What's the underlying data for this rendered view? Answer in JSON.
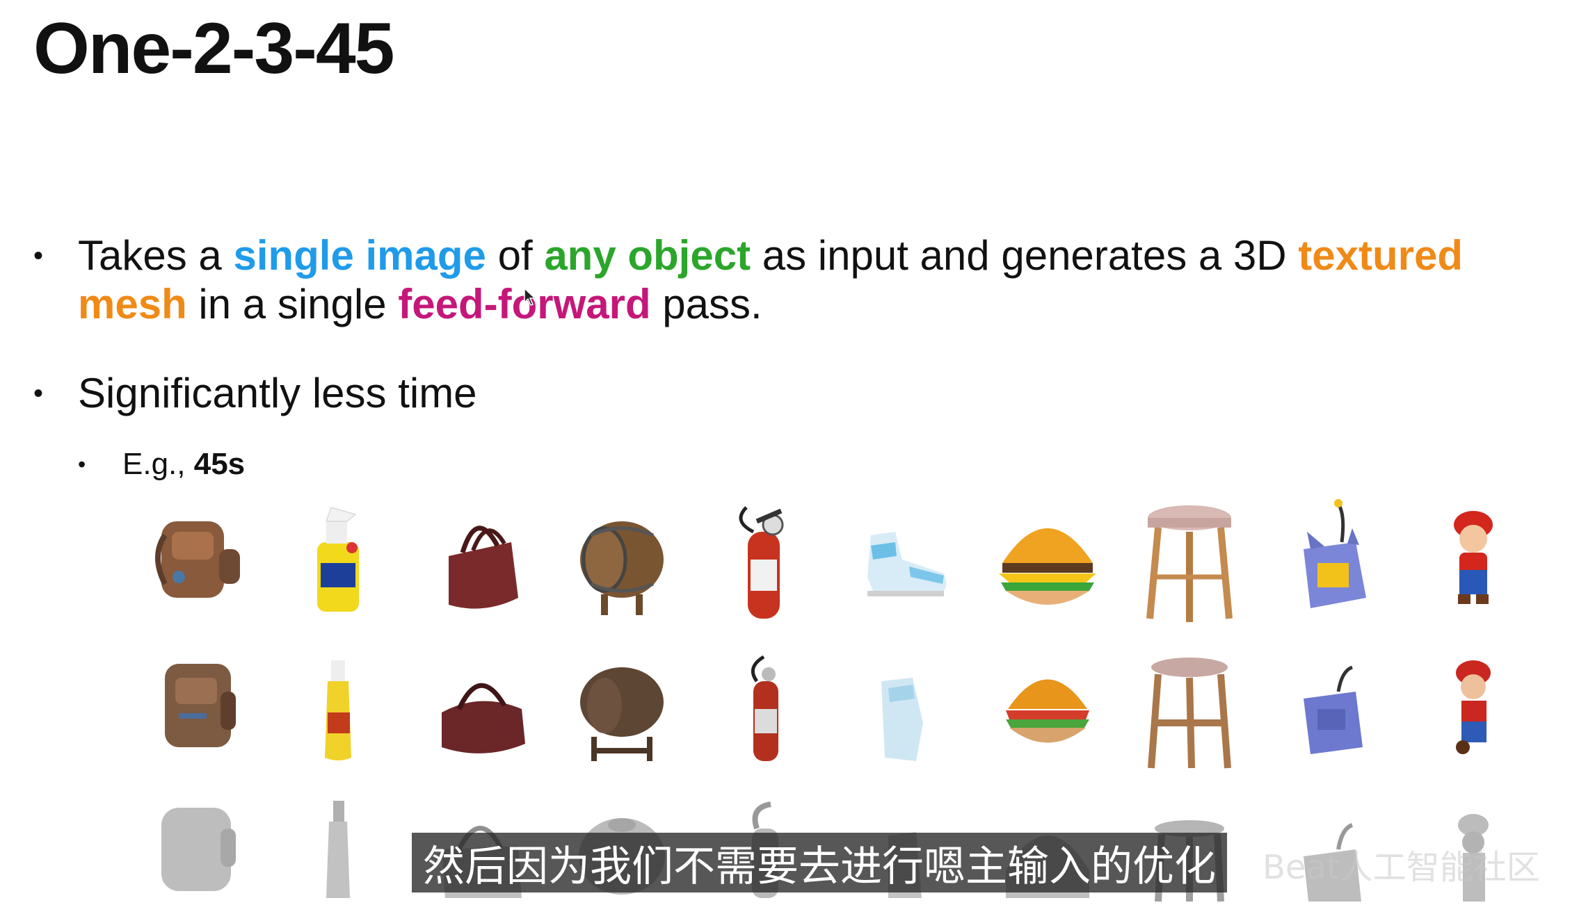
{
  "slide": {
    "title": "One-2-3-45",
    "bullet1": {
      "seg1": "Takes a ",
      "hl1": "single image",
      "seg2": " of ",
      "hl2": "any object",
      "seg3": " as input and generates a 3D ",
      "hl3": "textured mesh",
      "seg4": " in a single ",
      "hl4": "feed-forward",
      "seg5": " pass."
    },
    "bullet2": "Significantly less time",
    "sub_bullet": {
      "prefix": "E.g., ",
      "value": "45s"
    }
  },
  "colors": {
    "single_image": "#1f9bea",
    "any_object": "#2ba62b",
    "textured_mesh": "#f08a17",
    "feed_forward": "#c5177a"
  },
  "objects": [
    "backpack-icon",
    "spray-bottle-icon",
    "handbag-icon",
    "barrel-icon",
    "fire-extinguisher-icon",
    "sneaker-icon",
    "burger-icon",
    "stool-icon",
    "robot-box-icon",
    "mario-figure-icon"
  ],
  "rows": [
    "input-image",
    "textured-mesh",
    "geometry-mesh"
  ],
  "subtitle": "然后因为我们不需要去进行嗯主输入的优化",
  "watermark": "Beat人工智能社区"
}
